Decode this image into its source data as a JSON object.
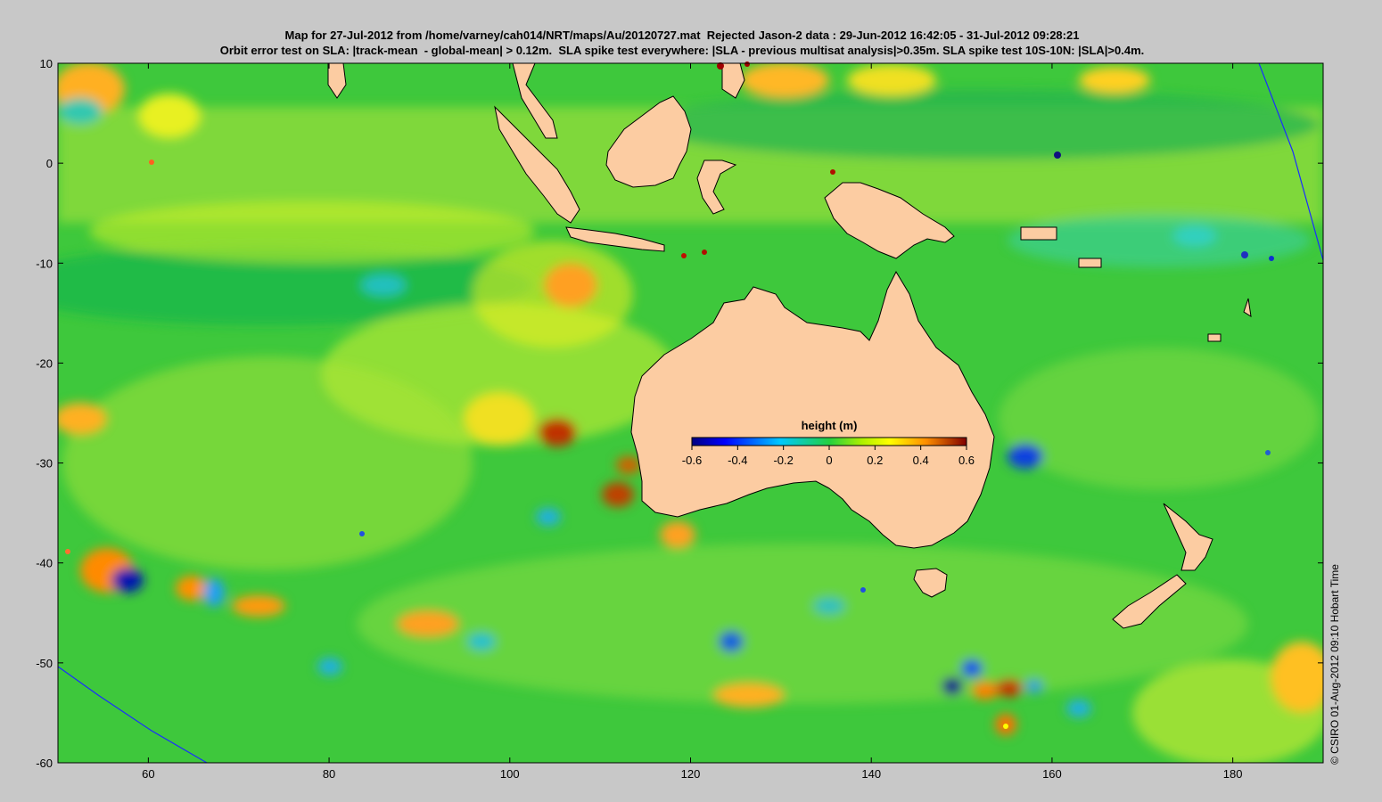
{
  "header": {
    "line1": "Map for 27-Jul-2012 from /home/varney/cah014/NRT/maps/Au/20120727.mat  Rejected Jason-2 data : 29-Jun-2012 16:42:05 - 31-Jul-2012 09:28:21",
    "line2": "Orbit error test on SLA: |track-mean  - global-mean| > 0.12m.  SLA spike test everywhere: |SLA - previous multisat analysis|>0.35m. SLA spike test 10S-10N: |SLA|>0.4m."
  },
  "credit": "© CSIRO 01-Aug-2012 09:10 Hobart Time",
  "axes": {
    "x_ticks": [
      "60",
      "80",
      "100",
      "120",
      "140",
      "160",
      "180"
    ],
    "y_ticks": [
      "10",
      "0",
      "-10",
      "-20",
      "-30",
      "-40",
      "-50",
      "-60"
    ],
    "x_range": [
      50,
      190
    ],
    "y_range": [
      -60,
      10
    ]
  },
  "colorbar": {
    "title": "height (m)",
    "ticks": [
      "-0.6",
      "-0.4",
      "-0.2",
      "0",
      "0.2",
      "0.4",
      "0.6"
    ],
    "range": [
      -0.6,
      0.6
    ]
  },
  "colors": {
    "land": "#fccca2",
    "background": "#c8c8c8",
    "ocean_base": "#3ec83c"
  }
}
